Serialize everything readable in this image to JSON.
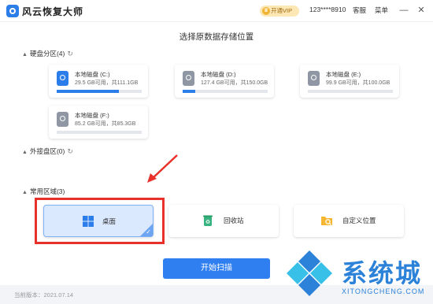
{
  "app": {
    "title": "风云恢复大师"
  },
  "titlebar": {
    "vip_label": "开通VIP",
    "account": "123****8910",
    "service": "客服",
    "menu": "菜单",
    "minimize": "—",
    "close": "✕"
  },
  "heading": "选择原数据存储位置",
  "sections": {
    "disks": {
      "label": "硬盘分区(4)"
    },
    "external": {
      "label": "外接盘区(0)"
    },
    "common": {
      "label": "常用区域(3)"
    }
  },
  "disks": [
    {
      "name": "本地磁盘 (C:)",
      "size": "29.5 GB可用，共111.1GB",
      "used_percent": 73,
      "system": true
    },
    {
      "name": "本地磁盘 (D:)",
      "size": "127.4 GB可用，共150.0GB",
      "used_percent": 15,
      "system": false
    },
    {
      "name": "本地磁盘 (E:)",
      "size": "99.9 GB可用，共100.0GB",
      "used_percent": 0,
      "system": false
    },
    {
      "name": "本地磁盘 (F:)",
      "size": "85.2 GB可用，共85.3GB",
      "used_percent": 0,
      "system": false
    }
  ],
  "areas": [
    {
      "label": "桌面",
      "icon": "windows-icon",
      "selected": true
    },
    {
      "label": "回收站",
      "icon": "recycle-bin-icon",
      "selected": false
    },
    {
      "label": "自定义位置",
      "icon": "folder-search-icon",
      "selected": false
    }
  ],
  "scan_button": "开始扫描",
  "footer": {
    "version": "当前版本：2021.07.14"
  },
  "watermark": {
    "title": "系统城",
    "subtitle": "XITONGCHENG.COM"
  },
  "colors": {
    "accent": "#2b7de9",
    "highlight": "#e8312a"
  }
}
